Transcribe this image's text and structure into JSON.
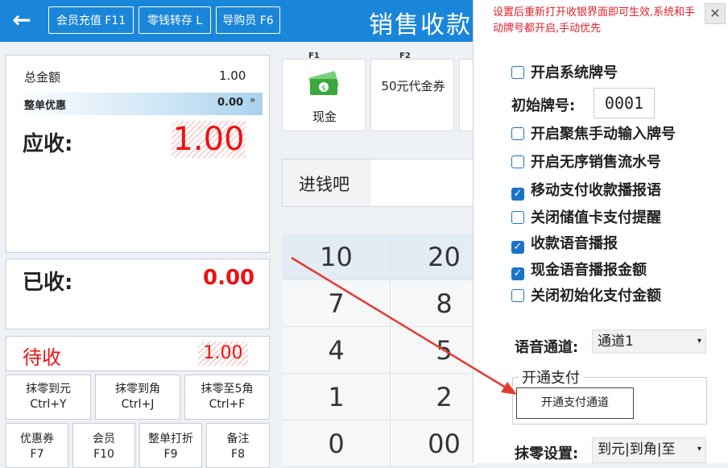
{
  "header": {
    "title": "销售收款",
    "buttons": [
      "会员充值 F11",
      "零钱转存 L",
      "导购员 F6"
    ]
  },
  "summary": {
    "total_label": "总金额",
    "total_value": "1.00",
    "discount_label": "整单优惠",
    "discount_value": "0.00",
    "receivable_label": "应收:",
    "receivable_value": "1.00",
    "received_label": "已收:",
    "received_value": "0.00",
    "pending_label": "待收",
    "pending_value": "1.00"
  },
  "functions": [
    {
      "line1": "抹零到元",
      "line2": "Ctrl+Y"
    },
    {
      "line1": "抹零到角",
      "line2": "Ctrl+J"
    },
    {
      "line1": "抹零至5角",
      "line2": "Ctrl+F"
    },
    {
      "line1": "优惠券",
      "line2": "F7"
    },
    {
      "line1": "会员",
      "line2": "F10"
    },
    {
      "line1": "整单打折",
      "line2": "F9"
    },
    {
      "line1": "备注",
      "line2": "F8"
    }
  ],
  "payments": [
    {
      "key": "F1",
      "label": "现金",
      "icon": "cash-icon"
    },
    {
      "key": "F2",
      "label": "50元代金券"
    }
  ],
  "input_label": "进钱吧",
  "keypad": [
    [
      "10",
      "20"
    ],
    [
      "7",
      "8"
    ],
    [
      "4",
      "5"
    ],
    [
      "1",
      "2"
    ],
    [
      "0",
      "00"
    ]
  ],
  "settings": {
    "note": "设置后重新打开收银界面即可生效,系统和手动牌号都开启,手动优先",
    "options": [
      {
        "label": "开启系统牌号",
        "checked": false
      },
      {
        "label": "开启聚焦手动输入牌号",
        "checked": false
      },
      {
        "label": "开启无序销售流水号",
        "checked": false
      },
      {
        "label": "移动支付收款播报语",
        "checked": true
      },
      {
        "label": "关闭储值卡支付提醒",
        "checked": false
      },
      {
        "label": "收款语音播报",
        "checked": true
      },
      {
        "label": "现金语音播报金额",
        "checked": true
      },
      {
        "label": "关闭初始化支付金额",
        "checked": false
      }
    ],
    "initial_no_label": "初始牌号:",
    "initial_no_value": "0001",
    "voice_label": "语音通道:",
    "voice_value": "通道1",
    "payment_group_label": "开通支付",
    "payment_button": "开通支付通道",
    "rounding_label": "抹零设置:",
    "rounding_value": "到元|到角|至"
  },
  "colors": {
    "brand": "#1a86d9",
    "accent": "#e11111",
    "check": "#1a73c9"
  }
}
